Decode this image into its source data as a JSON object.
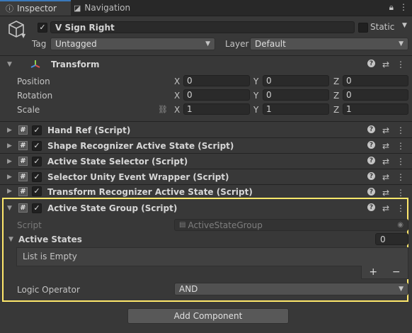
{
  "tabs": {
    "inspector": "Inspector",
    "navigation": "Navigation"
  },
  "header": {
    "object_name": "V Sign Right",
    "static_label": "Static",
    "tag_label": "Tag",
    "tag_value": "Untagged",
    "layer_label": "Layer",
    "layer_value": "Default"
  },
  "transform": {
    "title": "Transform",
    "rows": [
      {
        "label": "Position",
        "x": "0",
        "y": "0",
        "z": "0"
      },
      {
        "label": "Rotation",
        "x": "0",
        "y": "0",
        "z": "0"
      },
      {
        "label": "Scale",
        "x": "1",
        "y": "1",
        "z": "1"
      }
    ],
    "axis": {
      "x": "X",
      "y": "Y",
      "z": "Z"
    }
  },
  "components": [
    {
      "title": "Hand Ref (Script)"
    },
    {
      "title": "Shape Recognizer Active State (Script)"
    },
    {
      "title": "Active State Selector (Script)"
    },
    {
      "title": "Selector Unity Event Wrapper (Script)"
    },
    {
      "title": "Transform Recognizer Active State (Script)"
    }
  ],
  "group": {
    "title": "Active State Group (Script)",
    "script_label": "Script",
    "script_value": "ActiveStateGroup",
    "active_states_label": "Active States",
    "active_states_count": "0",
    "list_empty": "List is Empty",
    "plus": "+",
    "minus": "−",
    "logic_label": "Logic Operator",
    "logic_value": "AND"
  },
  "add_component": "Add Component",
  "colors": {
    "highlight": "#ffe86b",
    "tab_accent": "#3a79bb",
    "background": "#383838"
  }
}
